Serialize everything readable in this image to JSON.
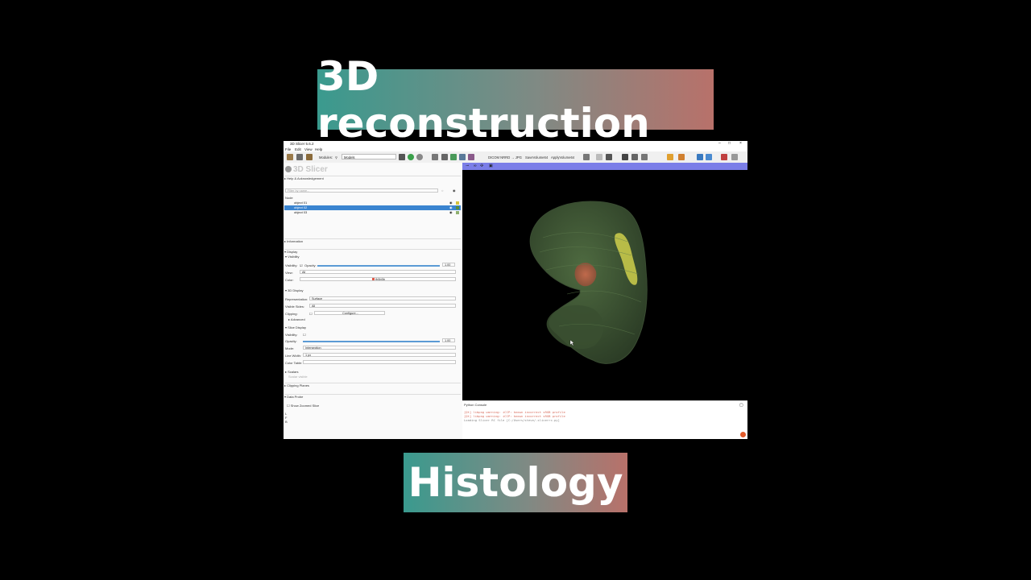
{
  "banners": {
    "top": "3D reconstruction",
    "bottom": "Histology"
  },
  "app": {
    "window_title": "3D Slicer 5.6.2",
    "menu": [
      "File",
      "Edit",
      "View",
      "Help"
    ],
    "toolbar": {
      "modules_label": "Modules:",
      "module_select": "Models",
      "dicom_button": "DICOM NRRD → JPG",
      "save_button": "SaveVolume64",
      "apply_button": "ApplyVolume64"
    },
    "logo_text": "3D Slicer",
    "sections": {
      "help": "Help & Acknowledgement",
      "information": "Information",
      "display": "Display",
      "visibility": "Visibility",
      "display_3d": "3D Display",
      "advanced": "Advanced",
      "slice_display": "Slice Display",
      "scalars": "Scalars",
      "clipping_planes": "Clipping Planes",
      "data_probe": "Data Probe"
    },
    "filter_placeholder": "Filter by name...",
    "tree_header": "Node",
    "tree_items": [
      {
        "name": "object 01",
        "color": "#d6c23a"
      },
      {
        "name": "object 02",
        "color": "#5b8e3a"
      },
      {
        "name": "object 03",
        "color": "#8fb070"
      }
    ],
    "visibility": {
      "label": "Visibility:",
      "opacity_label": "Opacity:",
      "opacity_value": "1.00",
      "view_label": "View:",
      "view_value": "All",
      "color_label": "Color:",
      "color_value": "fb5b5b"
    },
    "display3d": {
      "representation_label": "Representation:",
      "representation_value": "Surface",
      "visible_sides_label": "Visible Sides:",
      "visible_sides_value": "All",
      "clipping_label": "Clipping:",
      "configure_button": "Configure..."
    },
    "slice": {
      "visibility_label": "Visibility:",
      "opacity_label": "Opacity:",
      "opacity_value": "1.00",
      "mode_label": "Mode:",
      "mode_value": "Intersection",
      "line_width_label": "Line Width:",
      "line_width_value": "1 px",
      "color_table_label": "Color Table:"
    },
    "scalars_text": "Scalar visible",
    "data_probe": {
      "show_zoomed": "Show Zoomed Slice",
      "lines": [
        "L",
        "F",
        "B"
      ]
    },
    "console": {
      "title": "Python Console",
      "lines": [
        {
          "text": "[Qt] libpng warning: iCCP: known incorrect sRGB profile",
          "color": "#d86b5b"
        },
        {
          "text": "[Qt] libpng warning: iCCP: known incorrect sRGB profile",
          "color": "#d86b5b"
        },
        {
          "text": "Loading Slicer RC file [C:/Users/steve/.slicerrc.py]",
          "color": "#888888"
        }
      ]
    }
  }
}
